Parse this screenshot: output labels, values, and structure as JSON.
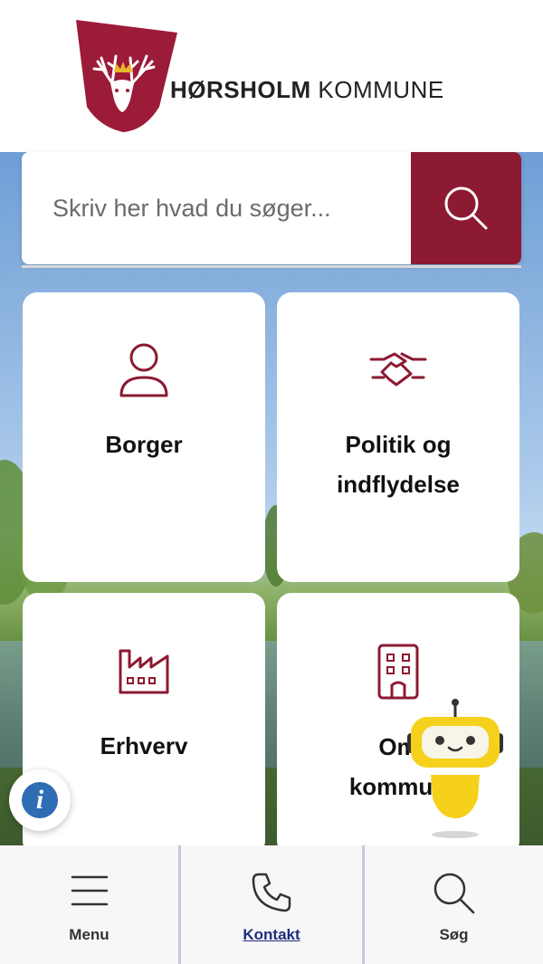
{
  "header": {
    "logo_bold": "HØRSHOLM",
    "logo_rest": "KOMMUNE"
  },
  "search": {
    "placeholder": "Skriv her hvad du søger...",
    "button_icon": "search-icon"
  },
  "tiles": [
    {
      "label_line1": "Borger",
      "label_line2": "",
      "icon": "person-icon"
    },
    {
      "label_line1": "Politik og",
      "label_line2": "indflydelse",
      "icon": "handshake-icon"
    },
    {
      "label_line1": "Erhverv",
      "label_line2": "",
      "icon": "factory-icon"
    },
    {
      "label_line1": "Om",
      "label_line2": "kommun",
      "icon": "building-icon"
    }
  ],
  "bottom_nav": {
    "menu": "Menu",
    "contact": "Kontakt",
    "search": "Søg"
  },
  "colors": {
    "brand": "#8c1a32",
    "info": "#2e6cb3",
    "robot": "#f5d11c"
  }
}
